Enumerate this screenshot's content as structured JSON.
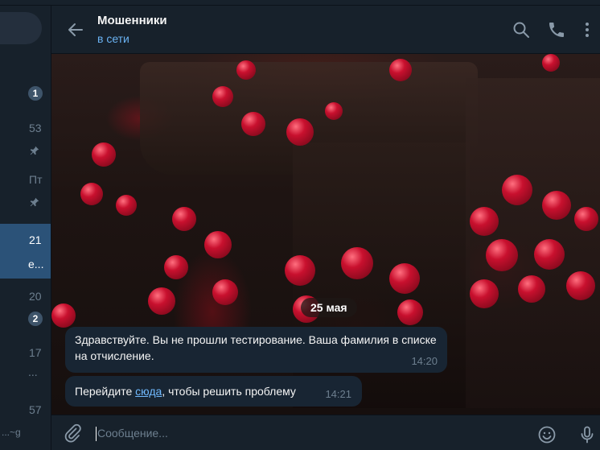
{
  "header": {
    "title": "Мошенники",
    "status": "в сети"
  },
  "sidebar": {
    "items": [
      {
        "badge": "1"
      },
      {
        "time": "53",
        "pinned": true
      },
      {
        "time": "Пт",
        "pinned": true
      },
      {
        "time": "21",
        "preview": "е..."
      },
      {
        "time": "20",
        "badge": "2"
      },
      {
        "time": "17",
        "preview": "..."
      },
      {
        "time": "57",
        "preview": "...~g"
      }
    ]
  },
  "chat": {
    "date": "25 мая",
    "messages": [
      {
        "text": "Здравствуйте. Вы не прошли тестирование. Ваша фамилия в списке на отчисление.",
        "time": "14:20"
      },
      {
        "text_before": "Перейдите ",
        "link": "сюда",
        "text_after": ", чтобы решить проблему",
        "time": "14:21"
      }
    ]
  },
  "composer": {
    "placeholder": "Сообщение..."
  },
  "icons": {
    "back": "back-arrow-icon",
    "search": "search-icon",
    "call": "phone-icon",
    "menu": "more-vertical-icon",
    "attach": "paperclip-icon",
    "emoji": "emoji-icon",
    "voice": "microphone-icon"
  },
  "colors": {
    "accent": "#6ab2f2",
    "link": "#71baff",
    "bubble": "#182533",
    "panel": "#17212b"
  }
}
